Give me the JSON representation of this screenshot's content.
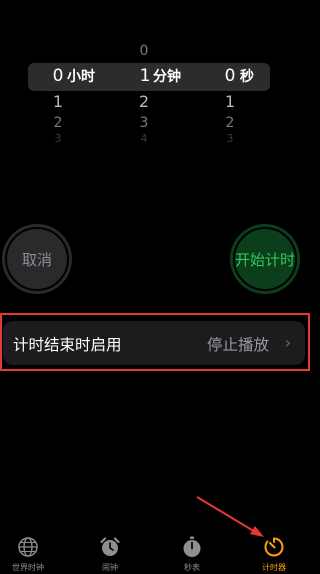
{
  "picker": {
    "hours": {
      "above": "",
      "selected": "0",
      "below": [
        "1",
        "2",
        "3"
      ],
      "unit": "小时"
    },
    "minutes": {
      "above": "0",
      "selected": "1",
      "below": [
        "2",
        "3",
        "4"
      ],
      "unit": "分钟"
    },
    "seconds": {
      "above": "",
      "selected": "0",
      "below": [
        "1",
        "2",
        "3"
      ],
      "unit": "秒"
    }
  },
  "buttons": {
    "cancel": "取消",
    "start": "开始计时"
  },
  "when_timer_ends": {
    "label": "计时结束时启用",
    "value": "停止播放",
    "chevron": "›"
  },
  "tabs": [
    {
      "label": "世界时钟",
      "icon": "globe-icon",
      "active": false
    },
    {
      "label": "闹钟",
      "icon": "alarm-clock-icon",
      "active": false
    },
    {
      "label": "秒表",
      "icon": "stopwatch-icon",
      "active": false
    },
    {
      "label": "计时器",
      "icon": "timer-icon",
      "active": true
    }
  ],
  "colors": {
    "accent_active_tab": "#ff9f0a",
    "start_button_text": "#34c759",
    "start_button_bg": "#0b3e1a",
    "cancel_button_bg": "#2a2a2c",
    "annotation_red": "#e53935"
  }
}
